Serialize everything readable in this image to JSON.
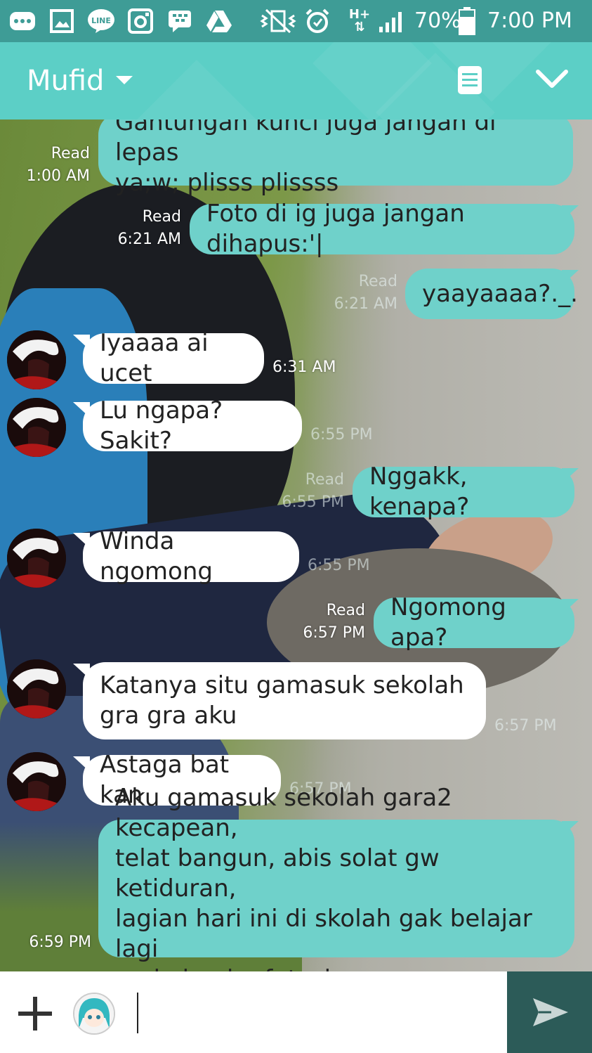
{
  "status_bar": {
    "battery_percent": "70%",
    "time": "7:00 PM",
    "network": "H+",
    "icons": [
      "more-icon",
      "gallery-icon",
      "line-icon",
      "instagram-icon",
      "bbm-icon",
      "drive-icon",
      "vibrate-icon",
      "alarm-icon",
      "data-arrows-icon",
      "signal-icon",
      "battery-icon"
    ],
    "line_badge": "LINE"
  },
  "header": {
    "title": "Mufid",
    "icons": [
      "dropdown-caret-icon",
      "notes-icon",
      "chevron-down-icon"
    ]
  },
  "messages": [
    {
      "dir": "out",
      "text": "Gantungan kunci juga jangan di lepas\nya;w; plisss plissss",
      "read": "Read",
      "time": "1:00 AM"
    },
    {
      "dir": "out",
      "text": "Foto di ig juga jangan dihapus:'|",
      "read": "Read",
      "time": "6:21 AM"
    },
    {
      "dir": "out",
      "text": "yaayaaaa?._.",
      "read": "Read",
      "time": "6:21 AM"
    },
    {
      "dir": "in",
      "text": "Iyaaaa ai ucet",
      "time": "6:31 AM"
    },
    {
      "dir": "in",
      "text": "Lu ngapa? Sakit?",
      "time": "6:55 PM"
    },
    {
      "dir": "out",
      "text": "Nggakk, kenapa?",
      "read": "Read",
      "time": "6:55 PM"
    },
    {
      "dir": "in",
      "text": "Winda ngomong",
      "time": "6:55 PM"
    },
    {
      "dir": "out",
      "text": "Ngomong apa?",
      "read": "Read",
      "time": "6:57 PM"
    },
    {
      "dir": "in",
      "text": "Katanya situ gamasuk sekolah\ngra gra aku",
      "time": "6:57 PM"
    },
    {
      "dir": "in",
      "text": "Astaga bat kan",
      "time": "6:57 PM"
    },
    {
      "dir": "out",
      "text": "Aku gamasuk sekolah gara2 kecapean,\ntelat bangun, abis solat gw ketiduran,\nlagian hari ini di skolah gak belajar lagi\npada lomba futsal",
      "time": "6:59 PM"
    }
  ],
  "composer": {
    "input_value": "",
    "icons": [
      "plus-icon",
      "sticker-icon",
      "send-icon"
    ]
  },
  "colors": {
    "header": "#5ccfc6",
    "status_bar": "#3e9c96",
    "bubble_out": "#6fd1ca",
    "bubble_in": "#ffffff",
    "send_button": "#2c5b58"
  }
}
